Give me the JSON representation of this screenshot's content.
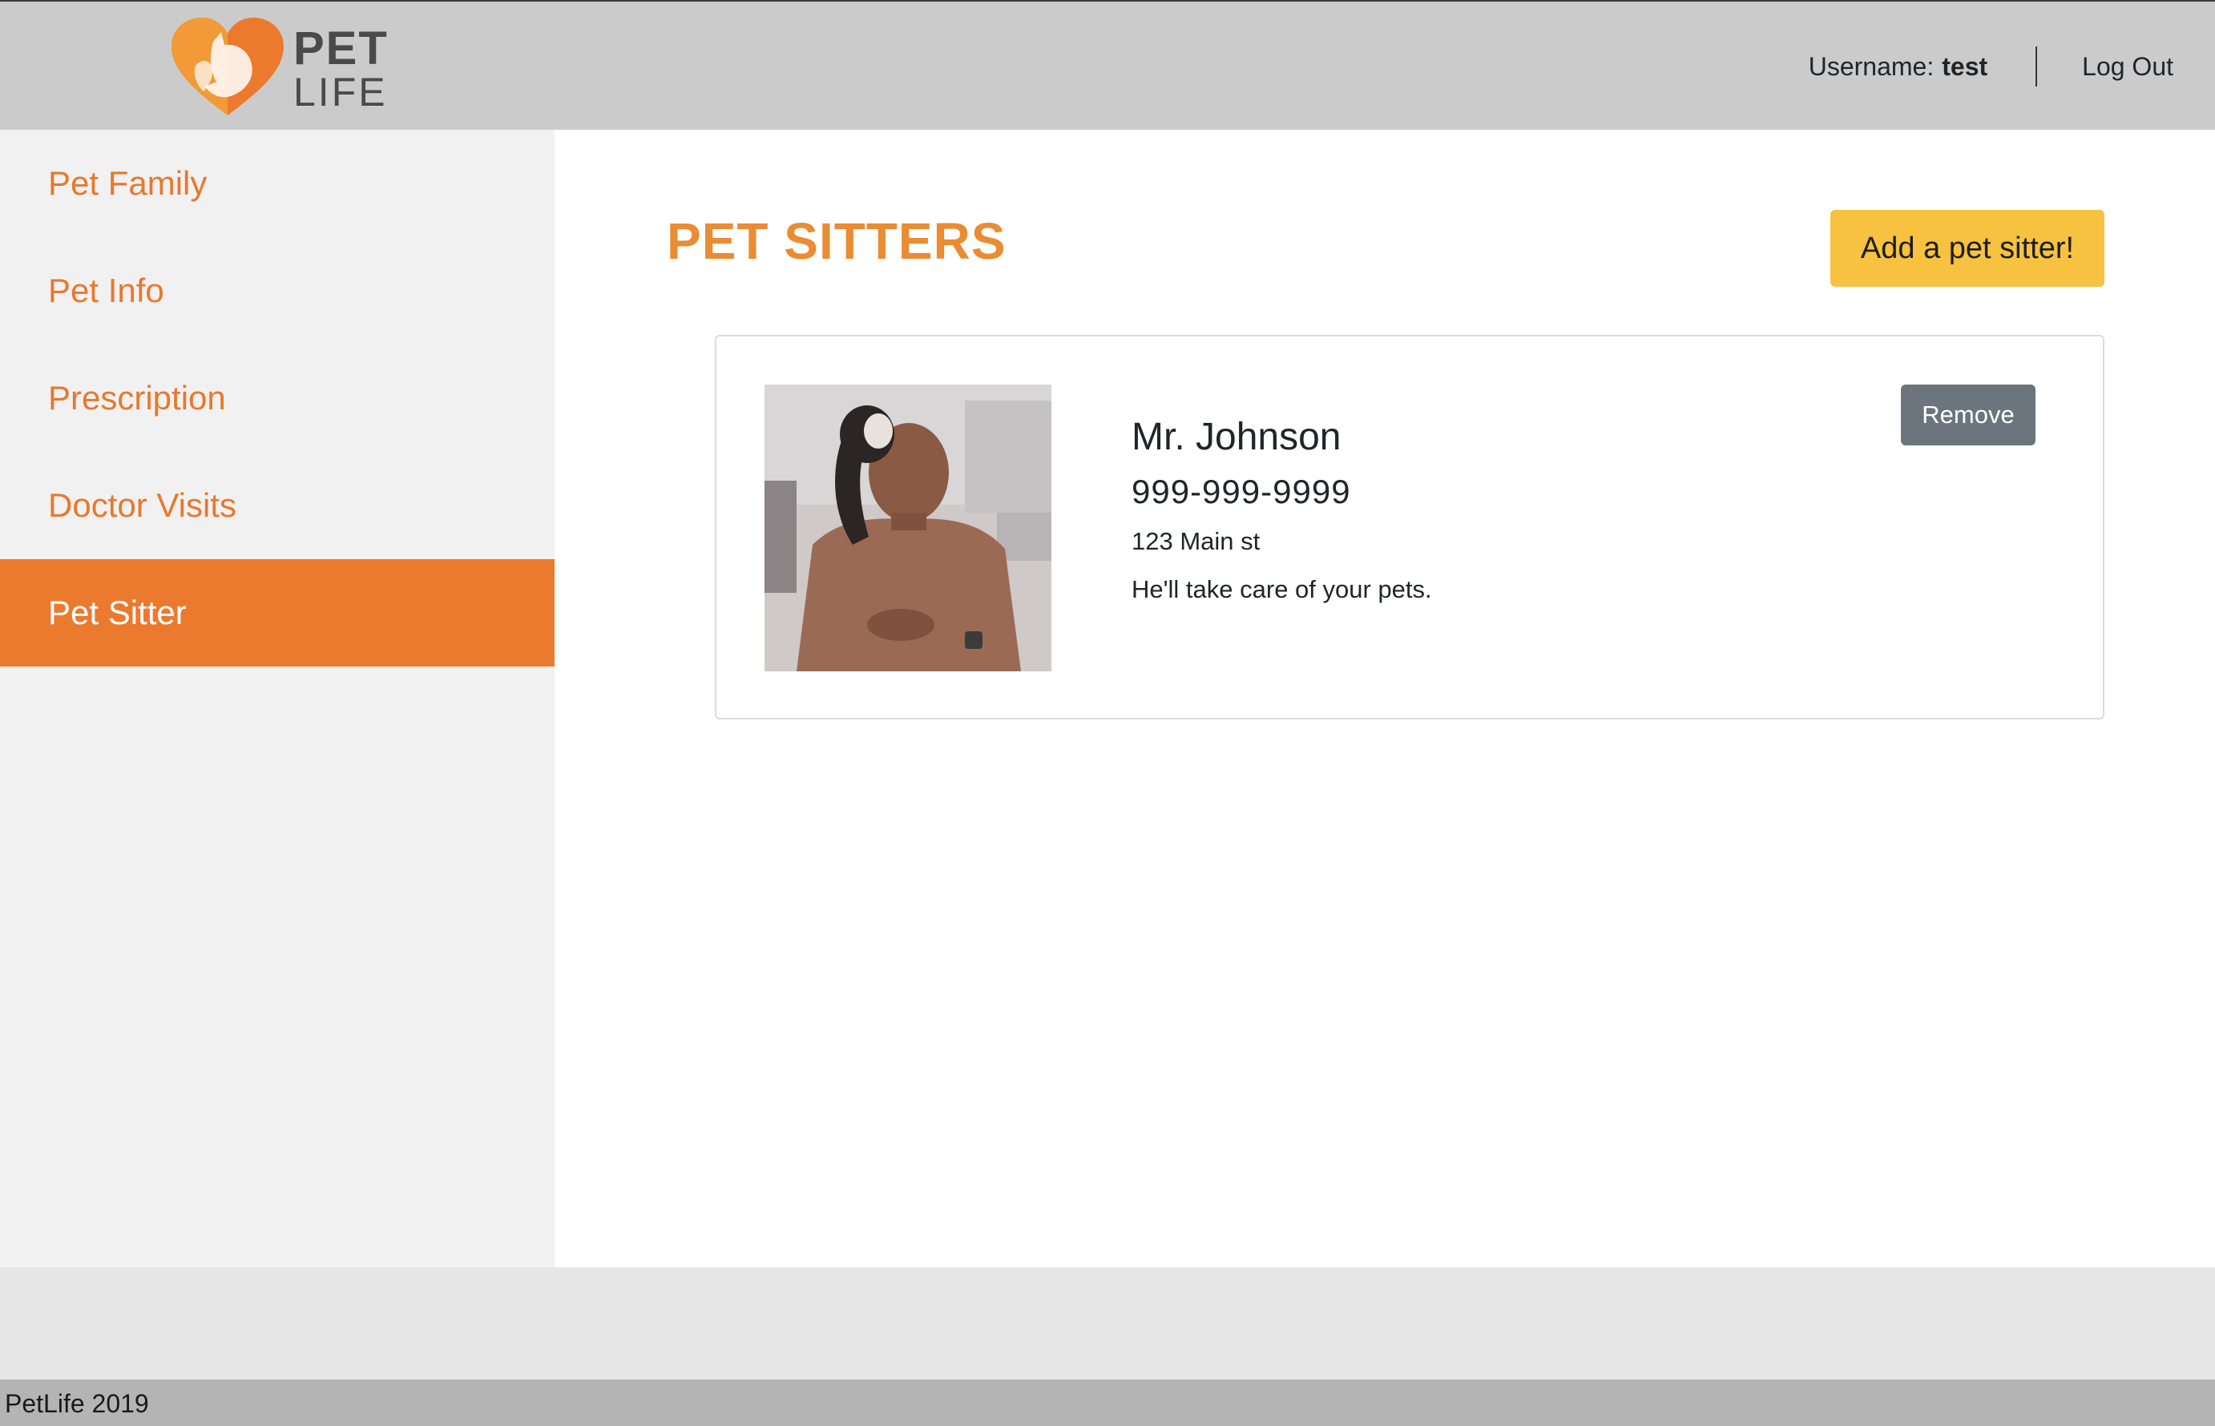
{
  "brand": {
    "logo_line1": "PET",
    "logo_line2": "LIFE",
    "accent": "#ec7a2e"
  },
  "header": {
    "username_label": "Username:",
    "username_value": "test",
    "logout_label": "Log Out"
  },
  "sidebar": {
    "items": [
      {
        "label": "Pet Family",
        "active": false
      },
      {
        "label": "Pet Info",
        "active": false
      },
      {
        "label": "Prescription",
        "active": false
      },
      {
        "label": "Doctor Visits",
        "active": false
      },
      {
        "label": "Pet Sitter",
        "active": true
      }
    ]
  },
  "main": {
    "title": "PET SITTERS",
    "add_button_label": "Add a pet sitter!",
    "sitters": [
      {
        "name": "Mr. Johnson",
        "phone": "999-999-9999",
        "address": "123 Main st",
        "note": "He'll take care of your pets.",
        "remove_label": "Remove"
      }
    ]
  },
  "footer": {
    "text": "PetLife 2019"
  },
  "colors": {
    "header_bg": "#cbcbcb",
    "sidebar_bg": "#f2f1f1",
    "nav_text": "#e8782d",
    "active_bg": "#ec7a2e",
    "title": "#ea8c33",
    "add_button": "#f6c240",
    "remove_button": "#6c757d"
  }
}
